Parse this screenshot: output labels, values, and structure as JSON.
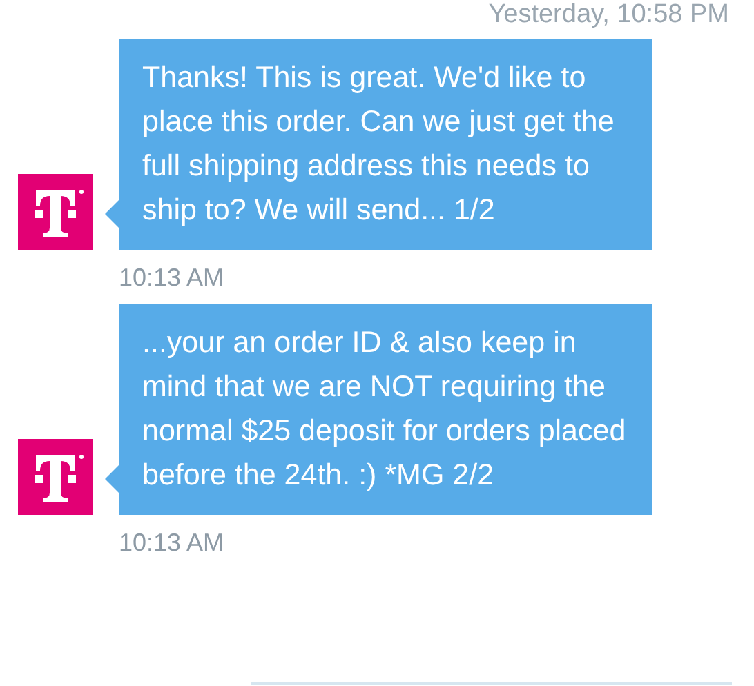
{
  "header_time": "Yesterday, 10:58 PM",
  "messages": [
    {
      "text": "Thanks! This is great. We'd like to place this order. Can we just get the full shipping address this needs to ship to? We will send... 1/2",
      "time": "10:13 AM"
    },
    {
      "text": "...your an order ID & also keep in mind that we are NOT requiring the normal $25 deposit for orders placed before the 24th. :) *MG 2/2",
      "time": "10:13 AM"
    }
  ]
}
